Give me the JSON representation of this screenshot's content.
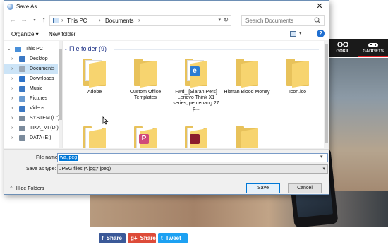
{
  "background_page": {
    "nav": [
      {
        "label": "GOKIL",
        "icon": "glasses-icon"
      },
      {
        "label": "GADGETS",
        "icon": "joystick-icon"
      }
    ],
    "share_buttons": [
      {
        "icon_text": "f",
        "label": "Share",
        "color": "#3b5998"
      },
      {
        "icon_text": "g+",
        "label": "Share",
        "color": "#dd4b39"
      },
      {
        "icon_text": "t",
        "label": "Tweet",
        "color": "#1da1f2"
      }
    ]
  },
  "dialog": {
    "title": "Save As",
    "close_symbol": "✕",
    "address": {
      "crumbs": [
        "This PC",
        "Documents"
      ],
      "separator": "›"
    },
    "search": {
      "placeholder": "Search Documents"
    },
    "toolbar": {
      "organize": "Organize ▾",
      "new_folder": "New folder"
    },
    "nav_pane": {
      "items": [
        {
          "label": "This PC",
          "icon": "pc-icon",
          "color": "#4a90d9",
          "selected": false
        },
        {
          "label": "Desktop",
          "icon": "desktop-icon",
          "color": "#3b78c4",
          "selected": false
        },
        {
          "label": "Documents",
          "icon": "documents-icon",
          "color": "#9aa7b6",
          "selected": true
        },
        {
          "label": "Downloads",
          "icon": "downloads-icon",
          "color": "#2e73c9",
          "selected": false
        },
        {
          "label": "Music",
          "icon": "music-icon",
          "color": "#3b78c4",
          "selected": false
        },
        {
          "label": "Pictures",
          "icon": "pictures-icon",
          "color": "#6a9bd1",
          "selected": false
        },
        {
          "label": "Videos",
          "icon": "videos-icon",
          "color": "#3b78c4",
          "selected": false
        },
        {
          "label": "SYSTEM (C:)",
          "icon": "drive-icon",
          "color": "#7b8b9c",
          "selected": false
        },
        {
          "label": "TIKA_MI (D:)",
          "icon": "drive-icon",
          "color": "#7b8b9c",
          "selected": false
        },
        {
          "label": "DATA (E:)",
          "icon": "drive-icon",
          "color": "#7b8b9c",
          "selected": false
        }
      ]
    },
    "content": {
      "group_header": "File folder (9)",
      "items": [
        {
          "name": "Adobe",
          "kind": "folder-paper"
        },
        {
          "name": "Custom Office Templates",
          "kind": "folder"
        },
        {
          "name": "Fwd_ [Siaran Pers] Lenovo Think X1 series, pemenang 27 p...",
          "kind": "folder-doc",
          "badge": "e",
          "badge_color": "#2b7cd3"
        },
        {
          "name": "Hitman Blood Money",
          "kind": "folder"
        },
        {
          "name": "Icon.ico",
          "kind": "folder"
        },
        {
          "name": "",
          "kind": "folder-paper"
        },
        {
          "name": "",
          "kind": "folder-doc",
          "badge": "P",
          "badge_color": "#d04a7a"
        },
        {
          "name": "",
          "kind": "folder-doc",
          "badge": "",
          "badge_color": "#8b1c2c"
        },
        {
          "name": "",
          "kind": "folder"
        }
      ]
    },
    "file_name": {
      "label": "File name:",
      "value": "wa.jpeg"
    },
    "save_as_type": {
      "label": "Save as type:",
      "value": "JPEG files (*.jpg;*.jpeg)"
    },
    "hide_folders": "Hide Folders",
    "buttons": {
      "save": "Save",
      "cancel": "Cancel"
    }
  }
}
